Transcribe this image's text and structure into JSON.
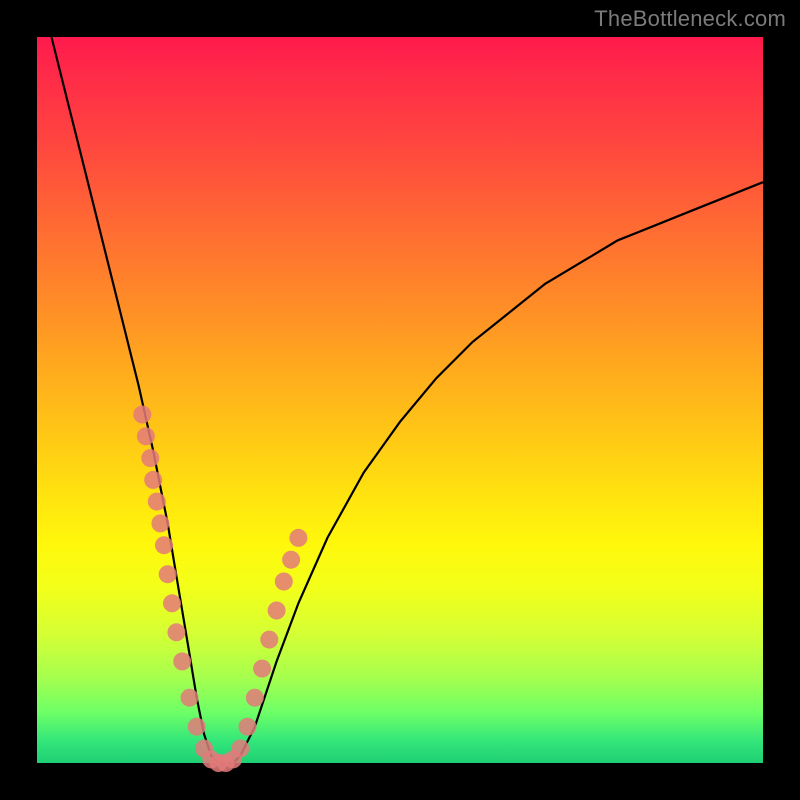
{
  "watermark": "TheBottleneck.com",
  "colors": {
    "frame": "#000000",
    "bead": "#e37a7a",
    "curve": "#000000",
    "gradient_stops": [
      {
        "pct": 0,
        "hex": "#ff1a4d"
      },
      {
        "pct": 16,
        "hex": "#ff4a3e"
      },
      {
        "pct": 36,
        "hex": "#ff8a28"
      },
      {
        "pct": 56,
        "hex": "#ffcb14"
      },
      {
        "pct": 70,
        "hex": "#fff80c"
      },
      {
        "pct": 88,
        "hex": "#a8ff4d"
      },
      {
        "pct": 100,
        "hex": "#1fcf74"
      }
    ]
  },
  "chart_data": {
    "type": "line",
    "title": "",
    "xlabel": "",
    "ylabel": "",
    "xlim": [
      0,
      100
    ],
    "ylim": [
      0,
      100
    ],
    "series": [
      {
        "name": "bottleneck-curve",
        "x": [
          2,
          4,
          6,
          8,
          10,
          12,
          14,
          16,
          17,
          18,
          19,
          20,
          21,
          22,
          23,
          24,
          25,
          26,
          27,
          28,
          30,
          33,
          36,
          40,
          45,
          50,
          55,
          60,
          65,
          70,
          75,
          80,
          85,
          90,
          95,
          100
        ],
        "y": [
          100,
          92,
          84,
          76,
          68,
          60,
          52,
          43,
          38,
          33,
          27,
          21,
          15,
          9,
          4,
          1,
          0,
          0,
          0,
          1,
          5,
          14,
          22,
          31,
          40,
          47,
          53,
          58,
          62,
          66,
          69,
          72,
          74,
          76,
          78,
          80
        ]
      }
    ],
    "beads": {
      "name": "highlight-points",
      "approximate": true,
      "x": [
        14.5,
        15.0,
        15.6,
        16.0,
        16.5,
        17.0,
        17.5,
        18.0,
        18.6,
        19.2,
        20.0,
        21.0,
        22.0,
        23.0,
        24.0,
        25.0,
        26.0,
        27.0,
        28.0,
        29.0,
        30.0,
        31.0,
        32.0,
        33.0,
        34.0,
        35.0,
        36.0
      ],
      "y": [
        48,
        45,
        42,
        39,
        36,
        33,
        30,
        26,
        22,
        18,
        14,
        9,
        5,
        2,
        0.5,
        0,
        0,
        0.5,
        2,
        5,
        9,
        13,
        17,
        21,
        25,
        28,
        31
      ]
    }
  }
}
